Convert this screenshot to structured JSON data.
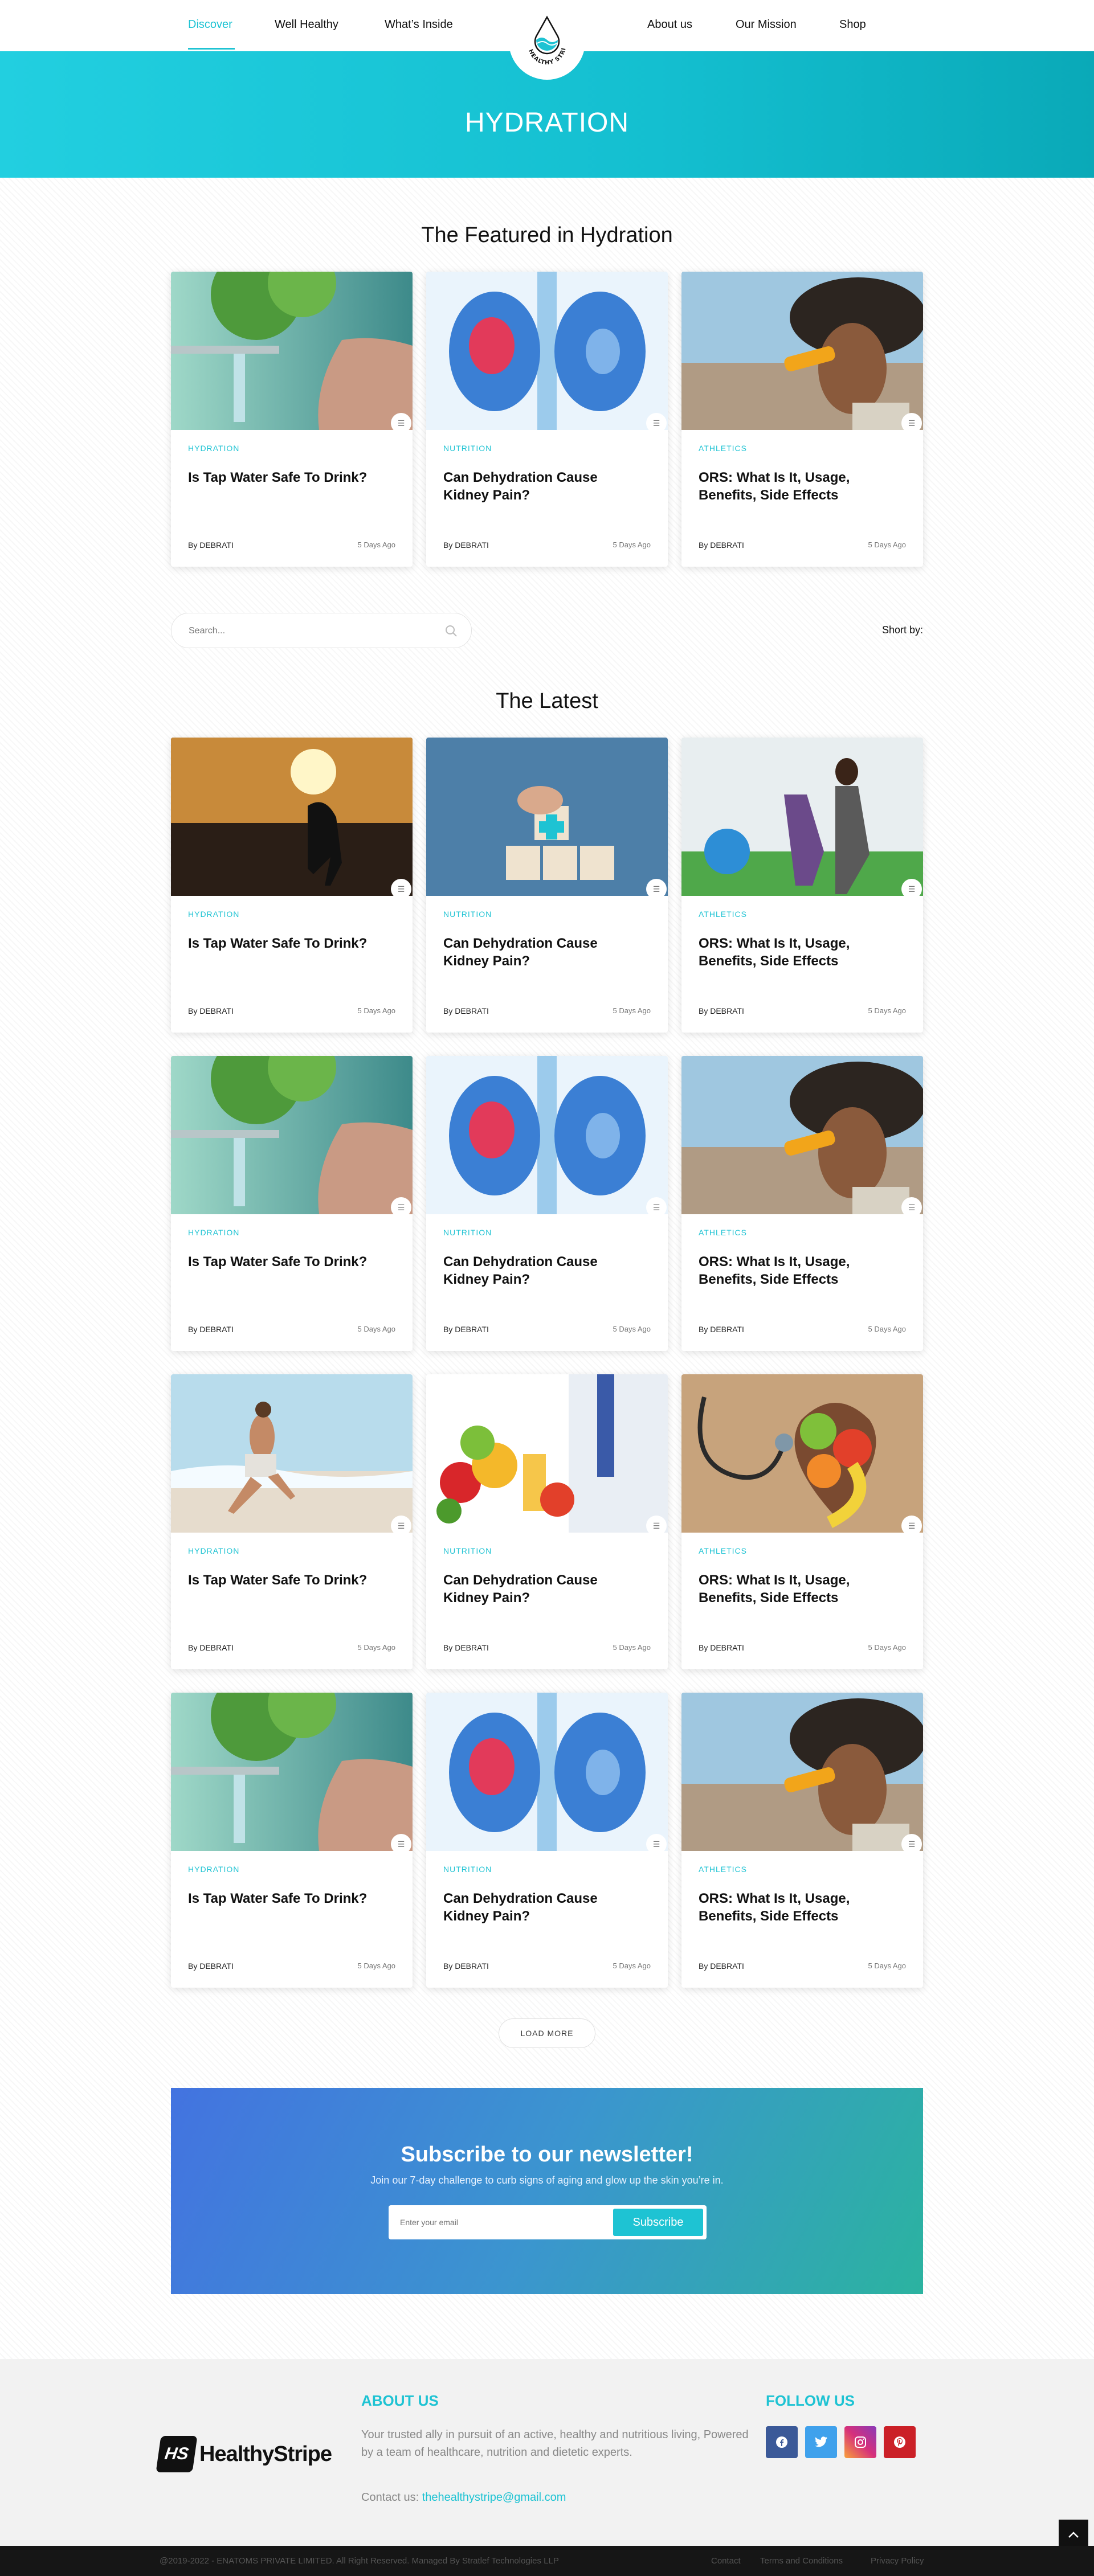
{
  "nav": {
    "left": [
      "Discover",
      "Well Healthy",
      "What’s Inside"
    ],
    "right": [
      "About us",
      "Our Mission",
      "Shop"
    ],
    "logo_text": "HEALTHY STRIPE"
  },
  "hero": {
    "title": "HYDRATION"
  },
  "featured": {
    "title": "The Featured in Hydration",
    "cards": [
      {
        "category": "HYDRATION",
        "title": "Is Tap Water Safe To Drink?",
        "author": "By DEBRATI",
        "date": "5 Days Ago"
      },
      {
        "category": "NUTRITION",
        "title": "Can Dehydration Cause Kidney Pain?",
        "author": "By DEBRATI",
        "date": "5 Days Ago"
      },
      {
        "category": "ATHLETICS",
        "title": "ORS: What Is It, Usage, Benefits, Side Effects",
        "author": "By DEBRATI",
        "date": "5 Days Ago"
      }
    ]
  },
  "search": {
    "placeholder": "Search...",
    "short_by": "Short by:"
  },
  "latest": {
    "title": "The Latest",
    "cards": [
      {
        "category": "HYDRATION",
        "title": "Is Tap Water Safe To Drink?",
        "author": "By DEBRATI",
        "date": "5 Days Ago"
      },
      {
        "category": "NUTRITION",
        "title": "Can Dehydration Cause Kidney Pain?",
        "author": "By DEBRATI",
        "date": "5 Days Ago"
      },
      {
        "category": "ATHLETICS",
        "title": "ORS: What Is It, Usage, Benefits, Side Effects",
        "author": "By DEBRATI",
        "date": "5 Days Ago"
      },
      {
        "category": "HYDRATION",
        "title": "Is Tap Water Safe To Drink?",
        "author": "By DEBRATI",
        "date": "5 Days Ago"
      },
      {
        "category": "NUTRITION",
        "title": "Can Dehydration Cause Kidney Pain?",
        "author": "By DEBRATI",
        "date": "5 Days Ago"
      },
      {
        "category": "ATHLETICS",
        "title": "ORS: What Is It, Usage, Benefits, Side Effects",
        "author": "By DEBRATI",
        "date": "5 Days Ago"
      },
      {
        "category": "HYDRATION",
        "title": "Is Tap Water Safe To Drink?",
        "author": "By DEBRATI",
        "date": "5 Days Ago"
      },
      {
        "category": "NUTRITION",
        "title": "Can Dehydration Cause Kidney Pain?",
        "author": "By DEBRATI",
        "date": "5 Days Ago"
      },
      {
        "category": "ATHLETICS",
        "title": "ORS: What Is It, Usage, Benefits, Side Effects",
        "author": "By DEBRATI",
        "date": "5 Days Ago"
      },
      {
        "category": "HYDRATION",
        "title": "Is Tap Water Safe To Drink?",
        "author": "By DEBRATI",
        "date": "5 Days Ago"
      },
      {
        "category": "NUTRITION",
        "title": "Can Dehydration Cause Kidney Pain?",
        "author": "By DEBRATI",
        "date": "5 Days Ago"
      },
      {
        "category": "ATHLETICS",
        "title": "ORS: What Is It, Usage, Benefits, Side Effects",
        "author": "By DEBRATI",
        "date": "5 Days Ago"
      }
    ],
    "load_more": "LOAD MORE"
  },
  "newsletter": {
    "title": "Subscribe to our newsletter!",
    "subtitle": "Join our 7-day challenge to curb signs of aging and glow up the skin you’re in.",
    "placeholder": "Enter your email",
    "button": "Subscribe"
  },
  "footer": {
    "brand": "HealthyStripe",
    "brand_mark": "HS",
    "about_title": "ABOUT US",
    "about_text": "Your trusted ally in pursuit of an active, healthy and nutritious living, Powered by a team of healthcare, nutrition and dietetic experts.",
    "contact_label": "Contact us:",
    "contact_email": "thehealthystripe@gmail.com",
    "follow_title": "FOLLOW US",
    "social": [
      "facebook-icon",
      "twitter-icon",
      "instagram-icon",
      "pinterest-icon"
    ],
    "copyright": "@2019-2022 - ENATOMS PRIVATE LIMITED. All Right Reserved. Managed By Stratlef Technologies LLP",
    "links": [
      "Contact",
      "Terms and Conditions",
      "Privacy Policy"
    ]
  },
  "colors": {
    "accent": "#1ec3d3",
    "hero": "#14bfd0",
    "dark": "#161616"
  }
}
